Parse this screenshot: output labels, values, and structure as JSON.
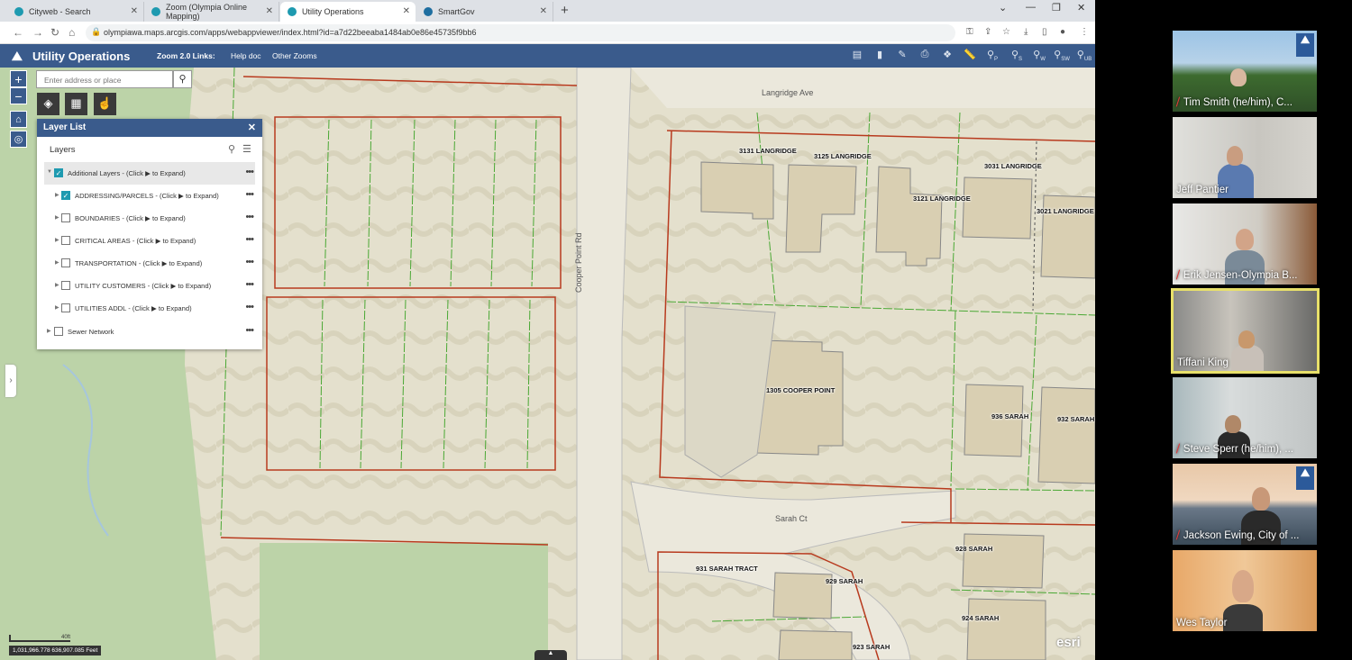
{
  "browser": {
    "tabs": [
      {
        "title": "Cityweb - Search",
        "color": "#1e9ab0"
      },
      {
        "title": "Zoom (Olympia Online Mapping)",
        "color": "#1e9ab0"
      },
      {
        "title": "Utility Operations",
        "color": "#1e9ab0"
      },
      {
        "title": "SmartGov",
        "color": "#1e6ea0"
      }
    ],
    "url": "olympiawa.maps.arcgis.com/apps/webappviewer/index.html?id=a7d22beeaba1484ab0e86e45735f9bb6"
  },
  "app": {
    "title": "Utility Operations",
    "links": [
      "Zoom 2.0 Links:",
      "Help doc",
      "Other Zooms"
    ],
    "toolbar_icons": [
      "print-icon",
      "basemap-icon",
      "measure-icon",
      "query-icon",
      "zoom-to-p-icon",
      "zoom-to-s-icon",
      "zoom-to-w-icon",
      "zoom-to-sw-icon",
      "zoom-to-ub-icon"
    ],
    "toolbar_labels": [
      "P",
      "S",
      "W",
      "SW",
      "UB"
    ]
  },
  "search": {
    "placeholder": "Enter address or place"
  },
  "layer_list": {
    "title": "Layer List",
    "subtitle": "Layers",
    "layers": [
      {
        "label": "Additional Layers - (Click ▶ to Expand)",
        "checked": true
      },
      {
        "label": "ADDRESSING/PARCELS - (Click ▶ to Expand)",
        "checked": true
      },
      {
        "label": "BOUNDARIES - (Click ▶ to Expand)",
        "checked": false
      },
      {
        "label": "CRITICAL AREAS - (Click ▶ to Expand)",
        "checked": false
      },
      {
        "label": "TRANSPORTATION - (Click ▶ to Expand)",
        "checked": false
      },
      {
        "label": "UTILITY CUSTOMERS - (Click ▶ to Expand)",
        "checked": false
      },
      {
        "label": "UTILITIES ADDL - (Click ▶ to Expand)",
        "checked": false
      },
      {
        "label": "Sewer Network",
        "checked": false
      }
    ]
  },
  "map": {
    "streets": [
      "Langridge Ave",
      "Cooper Point Rd",
      "Sarah Ct"
    ],
    "addresses": [
      "3131 LANGRIDGE",
      "3125 LANGRIDGE",
      "3031 LANGRIDGE",
      "3121 LANGRIDGE",
      "3021 LANGRIDGE",
      "1305 COOPER POINT",
      "936 SARAH",
      "932 SARAH",
      "928 SARAH",
      "931 SARAH TRACT",
      "929 SARAH",
      "924 SARAH",
      "923 SARAH"
    ],
    "coordinates": "1,031,966.778 636,907.085 Feet",
    "scale_label": "40ft",
    "attribution": "esri"
  },
  "participants": [
    {
      "name": "Tim Smith (he/him), C...",
      "muted": true,
      "active": false
    },
    {
      "name": "Jeff Pantier",
      "muted": false,
      "active": false
    },
    {
      "name": "Erik Jensen-Olympia B...",
      "muted": true,
      "active": false
    },
    {
      "name": "Tiffani King",
      "muted": false,
      "active": true
    },
    {
      "name": "Steve Sperr (he/him), ...",
      "muted": true,
      "active": false
    },
    {
      "name": "Jackson Ewing, City of ...",
      "muted": true,
      "active": false
    },
    {
      "name": "Wes Taylor",
      "muted": false,
      "active": false
    }
  ]
}
